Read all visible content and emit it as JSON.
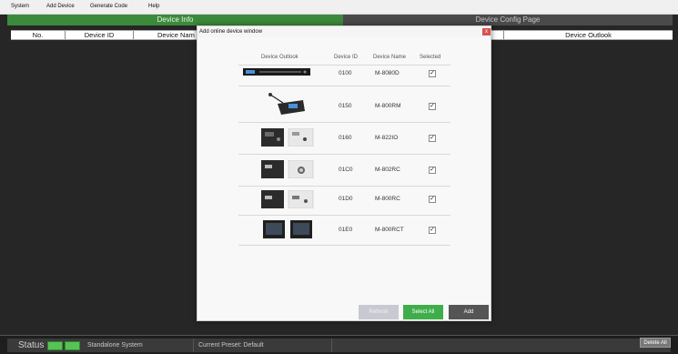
{
  "menu": {
    "items": [
      "System",
      "Add Device",
      "Generate Code",
      "Help"
    ]
  },
  "panels": {
    "left_title": "Device Info",
    "right_title": "Device Config Page"
  },
  "table": {
    "left_columns": [
      "No.",
      "Device ID",
      "Device Nam"
    ],
    "right_columns": [
      "Device Outlook"
    ]
  },
  "dialog": {
    "title": "Add online device window",
    "close_label": "x",
    "columns": [
      "Device Outlook",
      "Device ID",
      "Device Name",
      "Selected"
    ],
    "rows": [
      {
        "id": "0100",
        "name": "M-8080D",
        "selected": true,
        "outlook_icon": "rack-unit-icon"
      },
      {
        "id": "0150",
        "name": "M-800RM",
        "selected": true,
        "outlook_icon": "paging-microphone-icon"
      },
      {
        "id": "0160",
        "name": "M-822IO",
        "selected": true,
        "outlook_icon": "wall-panel-pair-icon"
      },
      {
        "id": "01C0",
        "name": "M-802RC",
        "selected": true,
        "outlook_icon": "wall-panel-pair-icon"
      },
      {
        "id": "01D0",
        "name": "M-800RC",
        "selected": true,
        "outlook_icon": "wall-panel-pair-icon"
      },
      {
        "id": "01E0",
        "name": "M-800RCT",
        "selected": true,
        "outlook_icon": "touch-panel-pair-icon"
      }
    ],
    "check_glyph": "✓",
    "buttons": {
      "refresh": "Refresh",
      "select_all": "Select All",
      "add": "Add"
    }
  },
  "status": {
    "label": "Status",
    "mode": "Standalone System",
    "preset": "Current Preset: Default",
    "delete_all": "Delete All",
    "led_color": "#55c455"
  },
  "colors": {
    "accent_green": "#3c8a3c",
    "select_all_green": "#3fae4a"
  }
}
